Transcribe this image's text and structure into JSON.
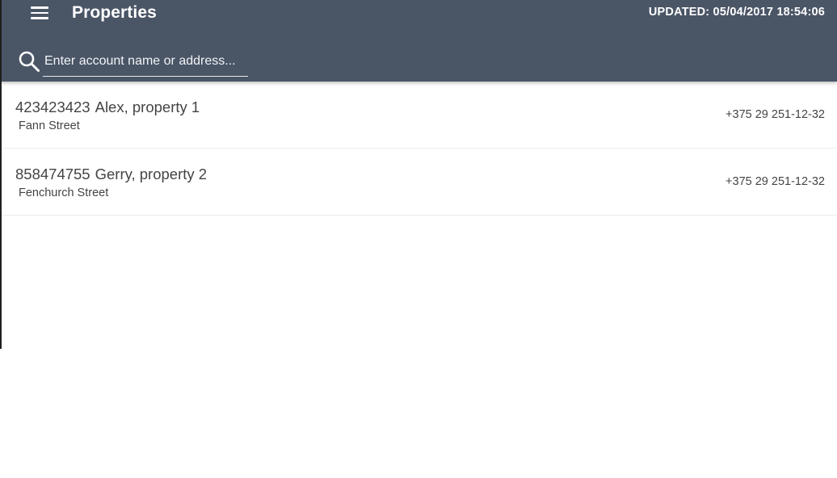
{
  "toolbar": {
    "title": "Properties",
    "updated": "UPDATED: 05/04/2017 18:54:06",
    "menu_icon": "hamburger-menu-icon"
  },
  "search": {
    "icon": "search-icon",
    "placeholder": "Enter account name or address...",
    "value": ""
  },
  "properties": [
    {
      "account": "423423423",
      "name": "Alex, property 1",
      "address": "Fann Street",
      "phone": "+375 29 251-12-32"
    },
    {
      "account": "858474755",
      "name": "Gerry, property 2",
      "address": "Fenchurch Street",
      "phone": "+375 29 251-12-32"
    }
  ],
  "colors": {
    "toolbar": "#4a5566",
    "text": "#444444",
    "divider": "#ececec"
  }
}
